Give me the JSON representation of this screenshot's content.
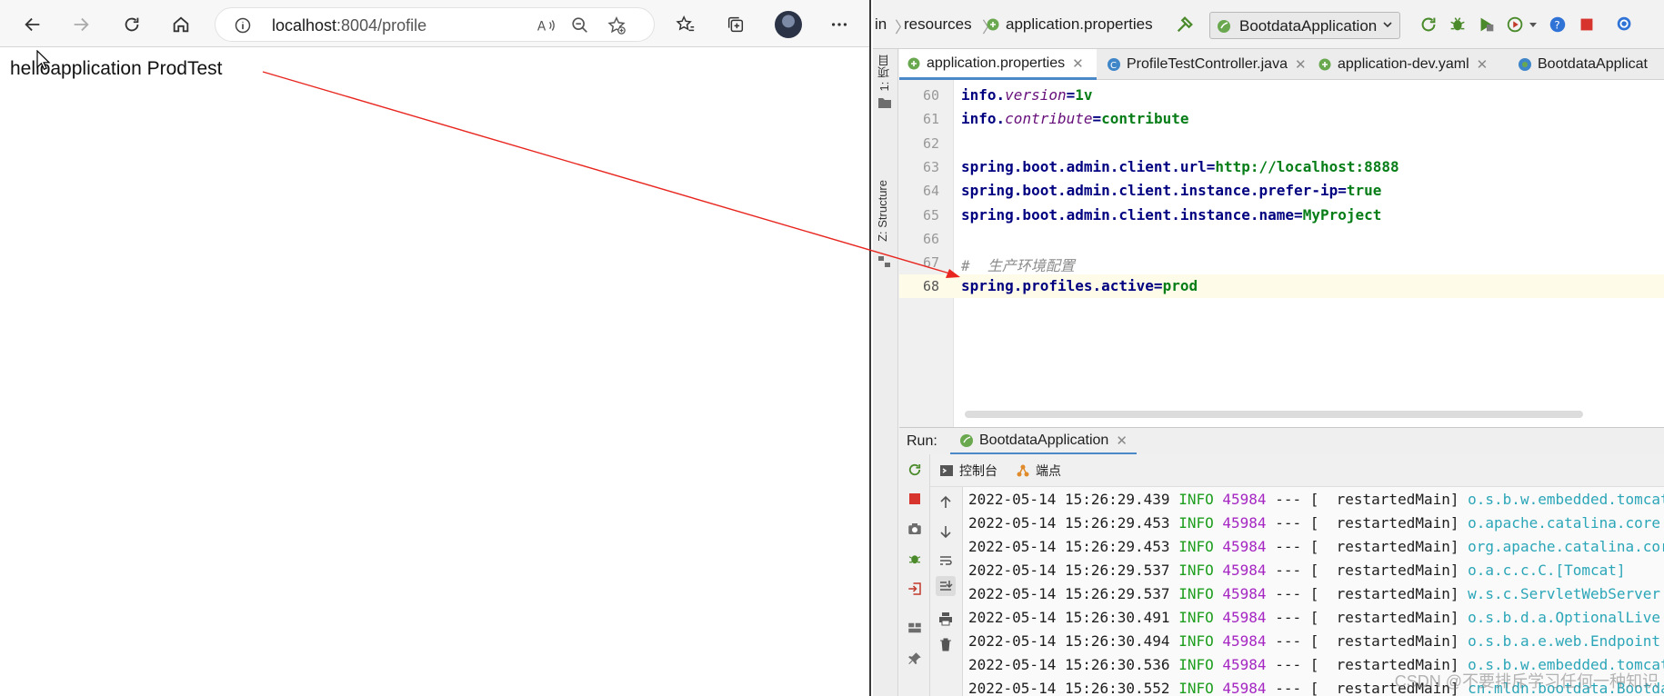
{
  "browser": {
    "url_host": "localhost",
    "url_rest": ":8004/profile",
    "page_text": "helloapplication ProdTest"
  },
  "ide": {
    "breadcrumbs": [
      "in",
      "resources",
      "application.properties"
    ],
    "run_config": "BootdataApplication",
    "side_tabs": [
      "1: 项目",
      "Z: Structure"
    ],
    "editor_tabs": [
      {
        "label": "application.properties",
        "active": true
      },
      {
        "label": "ProfileTestController.java",
        "active": false
      },
      {
        "label": "application-dev.yaml",
        "active": false
      },
      {
        "label": "BootdataApplicat",
        "active": false
      }
    ],
    "code_lines": [
      {
        "n": "60",
        "key": "info.",
        "key_it": "version",
        "eq": "=",
        "val": "1v"
      },
      {
        "n": "61",
        "key": "info.",
        "key_it": "contribute",
        "eq": "=",
        "val": "contribute"
      },
      {
        "n": "62"
      },
      {
        "n": "63",
        "key": "spring.boot.admin.client.url",
        "eq": "=",
        "val": "http://localhost:8888"
      },
      {
        "n": "64",
        "key": "spring.boot.admin.client.instance.prefer-ip",
        "eq": "=",
        "val": "true"
      },
      {
        "n": "65",
        "key": "spring.boot.admin.client.instance.name",
        "eq": "=",
        "val": "MyProject"
      },
      {
        "n": "66"
      },
      {
        "n": "67",
        "comment": "#  生产环境配置"
      },
      {
        "n": "68",
        "key": "spring.profiles.active",
        "eq": "=",
        "val": "prod",
        "current": true
      }
    ],
    "run": {
      "label": "Run:",
      "tab": "BootdataApplication",
      "console_tabs": [
        "控制台",
        "端点"
      ]
    },
    "log_lines": [
      {
        "ts": "2022-05-14 15:26:29.439",
        "level": "INFO",
        "pid": "45984",
        "sep": "---",
        "thread": "[  restartedMain]",
        "logger": "o.s.b.w.embedded.tomcat"
      },
      {
        "ts": "2022-05-14 15:26:29.453",
        "level": "INFO",
        "pid": "45984",
        "sep": "---",
        "thread": "[  restartedMain]",
        "logger": "o.apache.catalina.core"
      },
      {
        "ts": "2022-05-14 15:26:29.453",
        "level": "INFO",
        "pid": "45984",
        "sep": "---",
        "thread": "[  restartedMain]",
        "logger": "org.apache.catalina.core"
      },
      {
        "ts": "2022-05-14 15:26:29.537",
        "level": "INFO",
        "pid": "45984",
        "sep": "---",
        "thread": "[  restartedMain]",
        "logger": "o.a.c.c.C.[Tomcat]"
      },
      {
        "ts": "2022-05-14 15:26:29.537",
        "level": "INFO",
        "pid": "45984",
        "sep": "---",
        "thread": "[  restartedMain]",
        "logger": "w.s.c.ServletWebServer"
      },
      {
        "ts": "2022-05-14 15:26:30.491",
        "level": "INFO",
        "pid": "45984",
        "sep": "---",
        "thread": "[  restartedMain]",
        "logger": "o.s.b.d.a.OptionalLive"
      },
      {
        "ts": "2022-05-14 15:26:30.494",
        "level": "INFO",
        "pid": "45984",
        "sep": "---",
        "thread": "[  restartedMain]",
        "logger": "o.s.b.a.e.web.Endpoint"
      },
      {
        "ts": "2022-05-14 15:26:30.536",
        "level": "INFO",
        "pid": "45984",
        "sep": "---",
        "thread": "[  restartedMain]",
        "logger": "o.s.b.w.embedded.tomcat"
      },
      {
        "ts": "2022-05-14 15:26:30.552",
        "level": "INFO",
        "pid": "45984",
        "sep": "---",
        "thread": "[  restartedMain]",
        "logger": "cn.mldn.bootdata.Bootdata"
      }
    ],
    "watermark": "CSDN @不要排斥学习任何一种知识"
  }
}
